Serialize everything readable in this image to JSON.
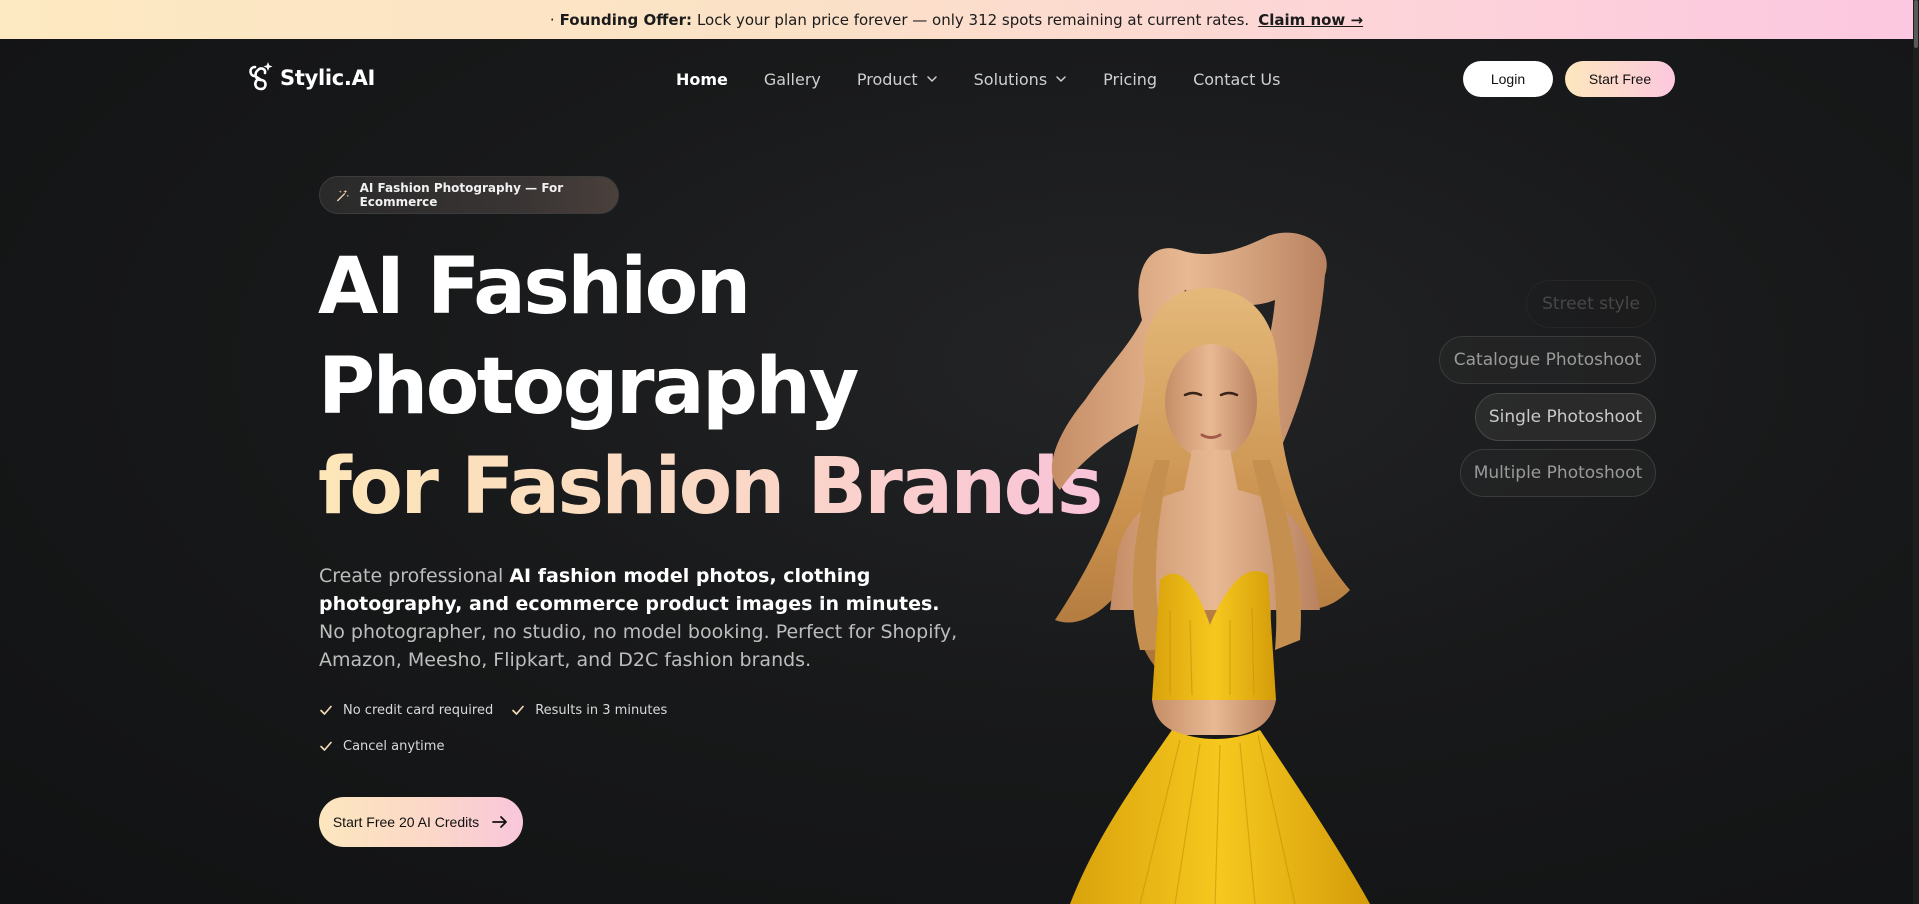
{
  "announcement": {
    "prefix": "·",
    "label": "Founding Offer:",
    "message": "Lock your plan price forever — only 312 spots remaining at current rates.",
    "link": "Claim now →"
  },
  "nav": {
    "brand": "Stylic.AI",
    "items": [
      {
        "label": "Home"
      },
      {
        "label": "Gallery"
      },
      {
        "label": "Product"
      },
      {
        "label": "Solutions"
      },
      {
        "label": "Pricing"
      },
      {
        "label": "Contact Us"
      }
    ],
    "login": "Login",
    "start": "Start Free"
  },
  "hero": {
    "badge": "AI Fashion Photography — For Ecommerce",
    "title_line1": "AI Fashion",
    "title_line2": "Photography",
    "title_line3": "for Fashion Brands",
    "desc_1": "Create professional ",
    "desc_bold": "AI fashion model photos, clothing photography, and ecommerce product images in minutes.",
    "desc_2": " No photographer, no studio, no model booking. Perfect for Shopify, Amazon, Meesho, Flipkart, and D2C fashion brands.",
    "checks": [
      "No credit card required",
      "Results in 3 minutes",
      "Cancel anytime"
    ],
    "cta": "Start Free 20 AI Credits"
  },
  "styles": [
    "Street style",
    "Catalogue Photoshoot",
    "Single Photoshoot",
    "Multiple Photoshoot"
  ],
  "colors": {
    "accent_from": "#fde7be",
    "accent_to": "#f9c6db",
    "background": "#141414",
    "dress": "#f3c21a"
  }
}
